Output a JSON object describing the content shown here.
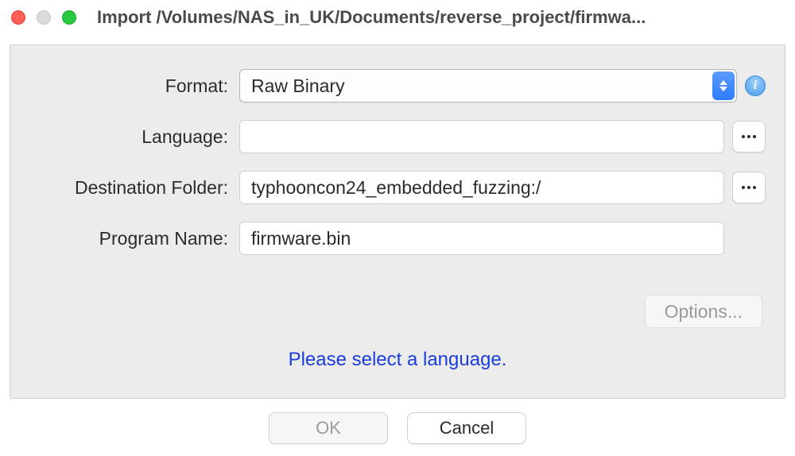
{
  "window": {
    "title": "Import /Volumes/NAS_in_UK/Documents/reverse_project/firmwa..."
  },
  "form": {
    "format": {
      "label": "Format:",
      "value": "Raw Binary"
    },
    "language": {
      "label": "Language:",
      "value": ""
    },
    "destination": {
      "label": "Destination Folder:",
      "value": "typhooncon24_embedded_fuzzing:/"
    },
    "program": {
      "label": "Program Name:",
      "value": "firmware.bin"
    }
  },
  "options_button": "Options...",
  "status_message": "Please select a language.",
  "buttons": {
    "ok": "OK",
    "cancel": "Cancel"
  }
}
